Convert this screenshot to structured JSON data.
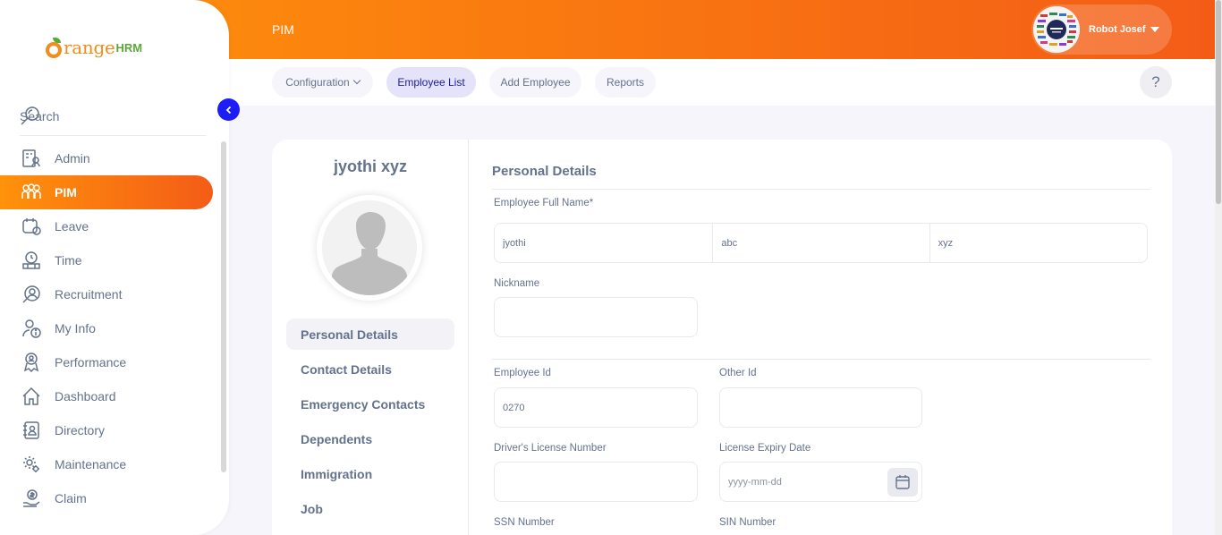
{
  "brand": {
    "logo_main": "range",
    "logo_suffix": "HRM"
  },
  "sidebar": {
    "search_label": "Search",
    "items": [
      {
        "label": "Admin",
        "icon": "admin-icon"
      },
      {
        "label": "PIM",
        "icon": "pim-icon",
        "active": true
      },
      {
        "label": "Leave",
        "icon": "leave-icon"
      },
      {
        "label": "Time",
        "icon": "time-icon"
      },
      {
        "label": "Recruitment",
        "icon": "recruitment-icon"
      },
      {
        "label": "My Info",
        "icon": "myinfo-icon"
      },
      {
        "label": "Performance",
        "icon": "performance-icon"
      },
      {
        "label": "Dashboard",
        "icon": "dashboard-icon"
      },
      {
        "label": "Directory",
        "icon": "directory-icon"
      },
      {
        "label": "Maintenance",
        "icon": "maintenance-icon"
      },
      {
        "label": "Claim",
        "icon": "claim-icon"
      }
    ]
  },
  "header": {
    "module": "PIM",
    "user_name": "Robot Josef"
  },
  "tabs": {
    "configuration": "Configuration",
    "employee_list": "Employee List",
    "add_employee": "Add Employee",
    "reports": "Reports",
    "help": "?"
  },
  "employee": {
    "name": "jyothi xyz"
  },
  "subnav": [
    "Personal Details",
    "Contact Details",
    "Emergency Contacts",
    "Dependents",
    "Immigration",
    "Job"
  ],
  "form": {
    "section_title": "Personal Details",
    "full_name_label": "Employee Full Name*",
    "first_name": "jyothi",
    "middle_name": "abc",
    "last_name": "xyz",
    "nickname_label": "Nickname",
    "nickname": "",
    "employee_id_label": "Employee Id",
    "employee_id": "0270",
    "other_id_label": "Other Id",
    "other_id": "",
    "license_label": "Driver's License Number",
    "license": "",
    "license_expiry_label": "License Expiry Date",
    "license_expiry_placeholder": "yyyy-mm-dd",
    "ssn_label": "SSN Number",
    "sin_label": "SIN Number"
  },
  "colors": {
    "accent_start": "#ff920b",
    "accent_end": "#f35c17",
    "collapse": "#1d1df5"
  }
}
